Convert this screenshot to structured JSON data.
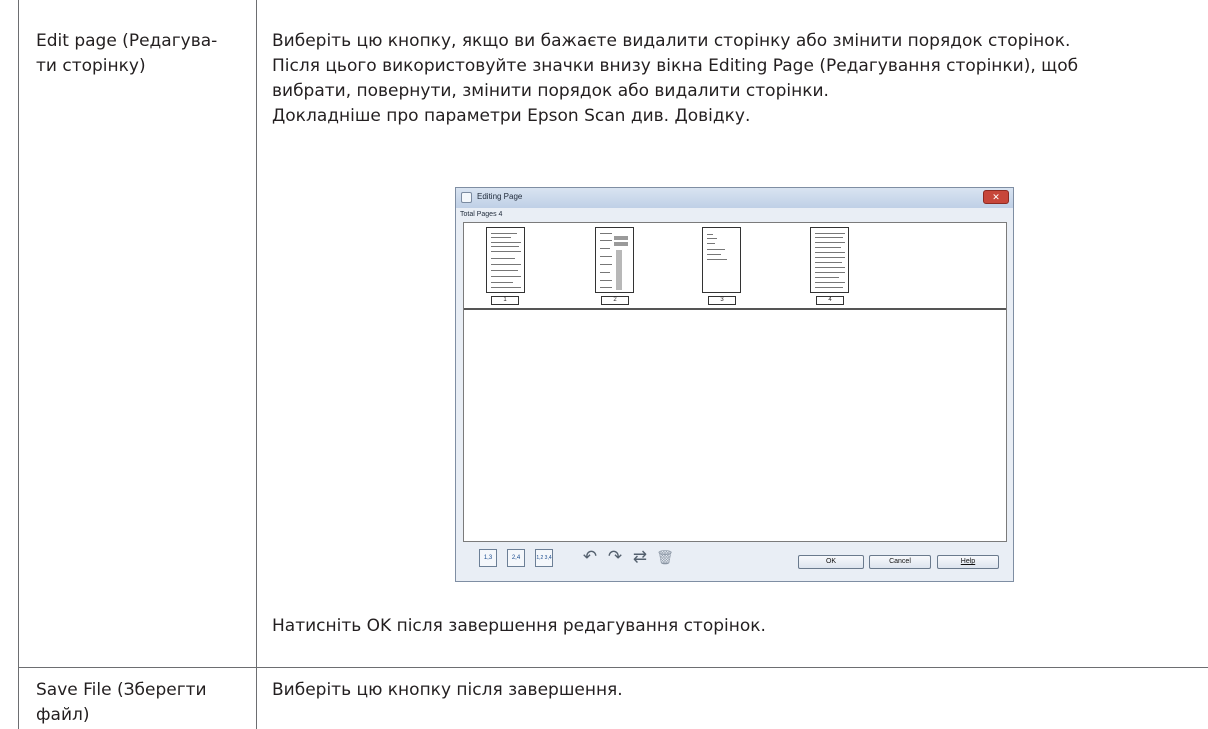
{
  "rows": [
    {
      "label": [
        "Edit page (Редагува-",
        "ти сторінку)"
      ],
      "description": [
        "Виберіть цю кнопку, якщо ви бажаєте видалити сторінку або змінити порядок сторінок.",
        "Після цього використовуйте значки внизу вікна Editing Page (Редагування сторінки), щоб",
        "вибрати, повернути, змінити порядок або видалити сторінки.",
        "Докладніше про параметри Epson Scan див. Довідку."
      ],
      "footer": "Натисніть OK після завершення редагування сторінок."
    },
    {
      "label": [
        "Save File (Зберегти",
        "файл)"
      ],
      "description": [
        "Виберіть цю кнопку після завершення."
      ]
    }
  ],
  "dialog": {
    "title": "Editing Page",
    "close_glyph": "✕",
    "total_pages": "Total Pages 4",
    "pages": [
      "1",
      "2",
      "3",
      "4"
    ],
    "toolbar_icons": [
      "select-odd-pages-icon",
      "select-even-pages-icon",
      "select-all-pages-icon",
      "rotate-left-icon",
      "rotate-right-icon",
      "reorder-icon",
      "delete-icon"
    ],
    "toolbar_text": [
      "1,3",
      "2,4",
      "1,2 3,4"
    ],
    "glyphs": {
      "rotate_left": "↶",
      "rotate_right": "↷",
      "reorder": "⇄",
      "delete": "🗑"
    },
    "buttons": {
      "ok": "OK",
      "cancel": "Cancel",
      "help": "Help"
    }
  }
}
